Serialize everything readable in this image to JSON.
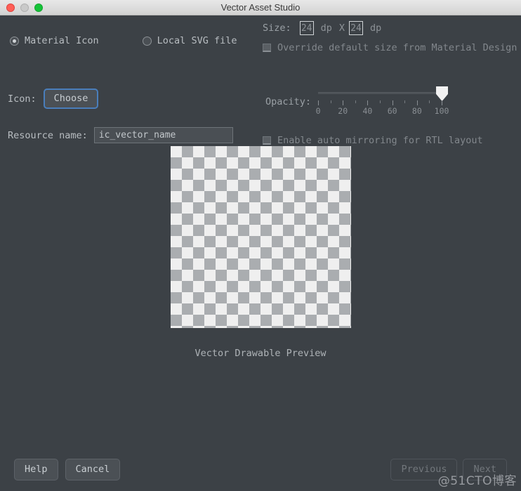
{
  "window": {
    "title": "Vector Asset Studio",
    "traffic_lights": [
      "close",
      "minimize",
      "zoom"
    ]
  },
  "asset_type": {
    "options": [
      {
        "label": "Material Icon",
        "selected": true
      },
      {
        "label": "Local SVG file",
        "selected": false
      }
    ]
  },
  "icon_row": {
    "label": "Icon:",
    "choose_button": "Choose"
  },
  "resource_row": {
    "label": "Resource name:",
    "value": "ic_vector_name",
    "placeholder": "ic_vector_name"
  },
  "size_row": {
    "label": "Size:",
    "width": "24",
    "height": "24",
    "unit_1": "dp",
    "separator": "X",
    "unit_2": "dp"
  },
  "override_row": {
    "label": "Override default size from Material Design",
    "checked": false
  },
  "opacity_row": {
    "label": "Opacity:",
    "value": 100,
    "ticks": [
      0,
      20,
      40,
      60,
      80,
      100
    ],
    "tick_labels": [
      "0",
      "20",
      "40",
      "60",
      "80",
      "100"
    ]
  },
  "rtl_row": {
    "label": "Enable auto mirroring for RTL layout",
    "checked": false
  },
  "preview": {
    "caption": "Vector Drawable Preview"
  },
  "footer": {
    "help": "Help",
    "cancel": "Cancel",
    "previous": "Previous",
    "next": "Next"
  },
  "watermark": "@51CTO博客",
  "colors": {
    "background": "#3c4146",
    "titlebar": "#e0e0e0",
    "accent_focus": "#4a7ebb",
    "text": "#b8bdc1",
    "text_dim": "#82878c",
    "close": "#ff5f57",
    "minimize": "#c9c9c9",
    "zoom": "#14c338"
  }
}
